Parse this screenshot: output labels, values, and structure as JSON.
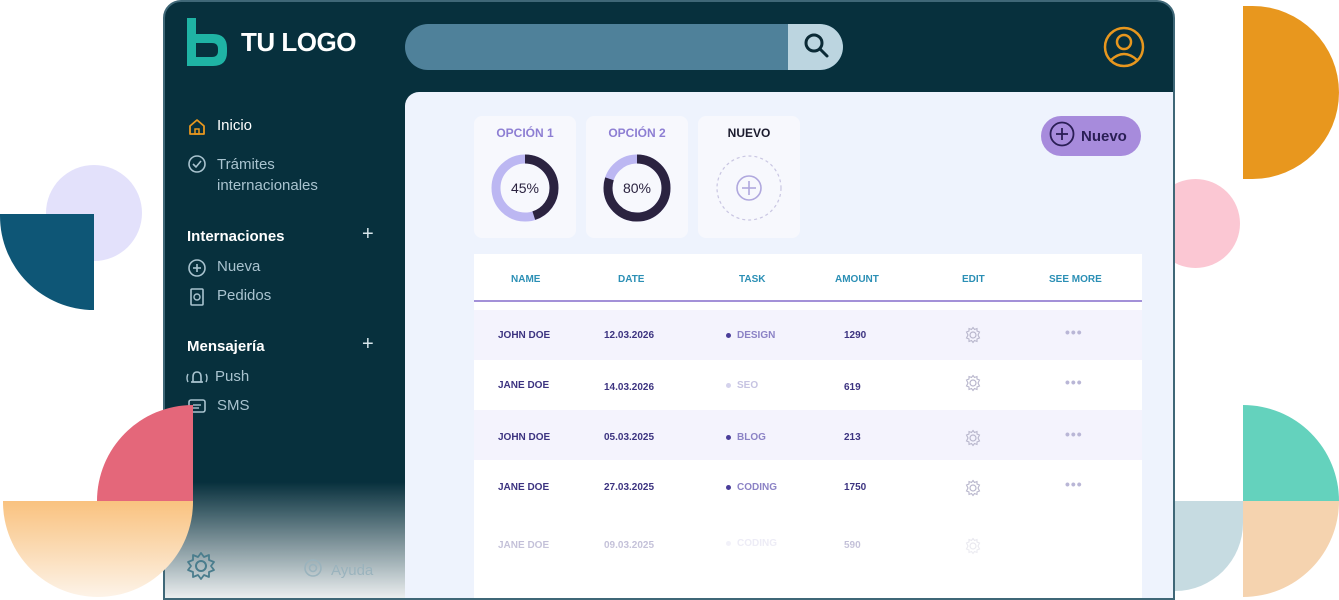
{
  "header": {
    "logo_text": "TU LOGO",
    "search_placeholder": ""
  },
  "sidebar": {
    "items": [
      {
        "label": "Inicio",
        "icon": "home-icon"
      },
      {
        "label": "Trámites internacionales",
        "icon": "check-circle-icon"
      }
    ],
    "sections": [
      {
        "title": "Internaciones",
        "items": [
          {
            "label": "Nueva",
            "icon": "plus-circle-icon"
          },
          {
            "label": "Pedidos",
            "icon": "document-icon"
          }
        ]
      },
      {
        "title": "Mensajería",
        "items": [
          {
            "label": "Push",
            "icon": "bell-icon"
          },
          {
            "label": "SMS",
            "icon": "message-icon"
          }
        ]
      }
    ],
    "footer": {
      "help_label": "Ayuda"
    }
  },
  "cards": [
    {
      "title": "OPCIÓN 1",
      "value": 45,
      "value_label": "45%"
    },
    {
      "title": "OPCIÓN 2",
      "value": 80,
      "value_label": "80%"
    },
    {
      "title": "NUEVO"
    }
  ],
  "new_button_label": "Nuevo",
  "table": {
    "columns": [
      "NAME",
      "DATE",
      "TASK",
      "AMOUNT",
      "EDIT",
      "SEE MORE"
    ],
    "rows": [
      {
        "name": "JOHN DOE",
        "date": "12.03.2026",
        "task": "DESIGN",
        "amount": "1290"
      },
      {
        "name": "JANE DOE",
        "date": "14.03.2026",
        "task": "SEO",
        "amount": "619"
      },
      {
        "name": "JOHN DOE",
        "date": "05.03.2025",
        "task": "BLOG",
        "amount": "213"
      },
      {
        "name": "JANE DOE",
        "date": "27.03.2025",
        "task": "CODING",
        "amount": "1750"
      },
      {
        "name": "JANE DOE",
        "date": "09.03.2025",
        "task": "CODING",
        "amount": "590"
      }
    ]
  },
  "colors": {
    "app_bg": "#07303d",
    "accent_purple": "#a78bdc",
    "accent_orange": "#e8971e",
    "logo_teal": "#1fb3a4"
  }
}
